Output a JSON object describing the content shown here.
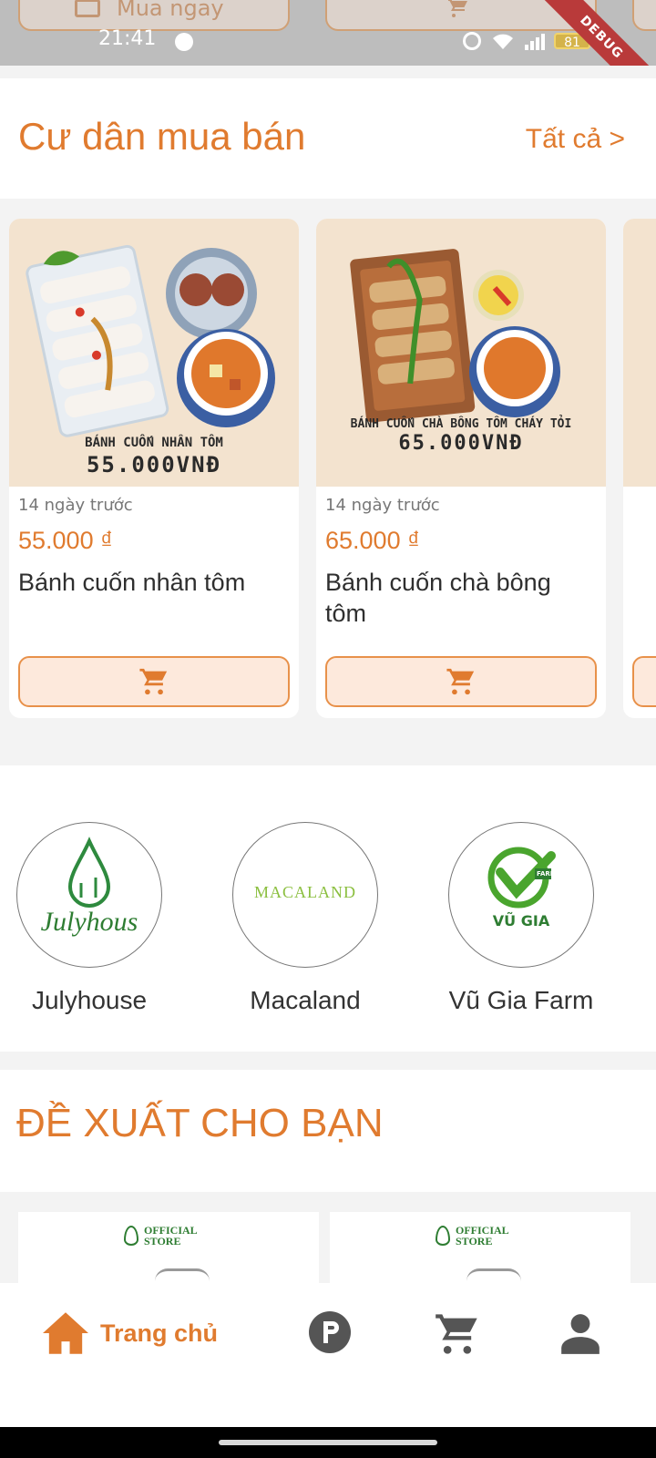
{
  "status_bar": {
    "time": "21:41",
    "battery": "81",
    "debug_banner": "DEBUG"
  },
  "top_partial": {
    "buy_now_label": "Mua ngay"
  },
  "residents_section": {
    "title": "Cư dân mua bán",
    "see_all": "Tất cả >"
  },
  "products": [
    {
      "image_caption_line1": "BÁNH CUỐN NHÂN TÔM",
      "image_caption_line2": "55.000VNĐ",
      "posted_ago": "14 ngày trước",
      "price": "55.000 ₫",
      "name": "Bánh cuốn nhân tôm"
    },
    {
      "image_caption_line1": "BÁNH CUỐN CHÀ BÔNG TÔM CHÁY TỎI",
      "image_caption_line2": "65.000VNĐ",
      "posted_ago": "14 ngày trước",
      "price": "65.000 ₫",
      "name": "Bánh cuốn chà bông tôm"
    }
  ],
  "stores": [
    {
      "name": "Julyhouse",
      "logo_text": "Julyhous"
    },
    {
      "name": "Macaland",
      "logo_text": "MACALAND"
    },
    {
      "name": "Vũ Gia Farm",
      "logo_text": "VŨ GIA",
      "logo_badge": "FARM"
    }
  ],
  "recommend_section": {
    "title": "ĐỀ XUẤT CHO BẠN",
    "badge_line1": "OFFICIAL",
    "badge_line2": "STORE"
  },
  "bottom_nav": {
    "home_label": "Trang chủ",
    "active_color": "#e07b2f",
    "inactive_color": "#555555",
    "icons": [
      "home-icon",
      "points-icon",
      "cart-icon",
      "profile-icon"
    ]
  },
  "colors": {
    "accent": "#e07b2f",
    "button_fill": "#fde9dc"
  }
}
